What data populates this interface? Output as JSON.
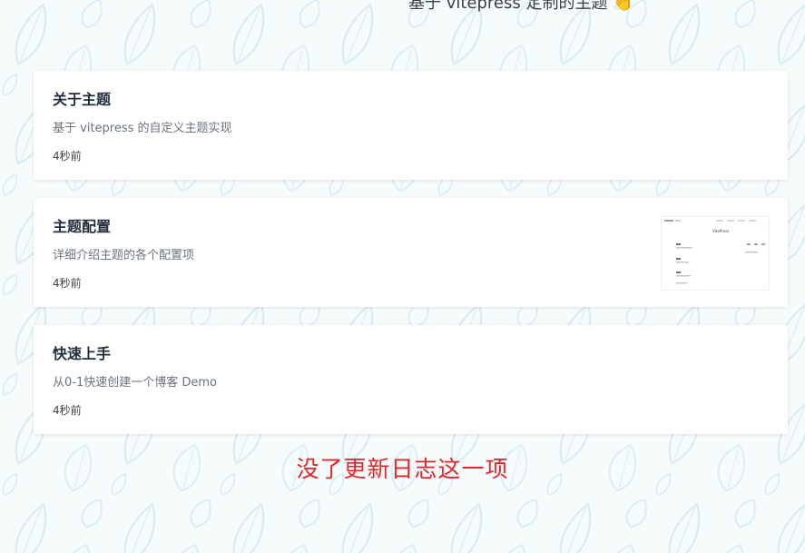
{
  "header": {
    "title": "基于 vitepress 定制的主题 👏"
  },
  "articles": [
    {
      "title": "关于主题",
      "description": "基于 vitepress 的自定义主题实现",
      "time": "4秒前",
      "has_thumbnail": false
    },
    {
      "title": "主题配置",
      "description": "详细介绍主题的各个配置项",
      "time": "4秒前",
      "has_thumbnail": true
    },
    {
      "title": "快速上手",
      "description": "从0-1快速创建一个博客 Demo",
      "time": "4秒前",
      "has_thumbnail": false
    }
  ],
  "thumbnail": {
    "brand": "VitePress"
  },
  "annotation": {
    "text": "没了更新日志这一项",
    "color": "#e3252c"
  },
  "colors": {
    "background": "#f6fbfc",
    "leaf_pattern": "#d9ecf1",
    "card": "#ffffff",
    "title": "#1f2d3d",
    "description": "#6b7280"
  }
}
